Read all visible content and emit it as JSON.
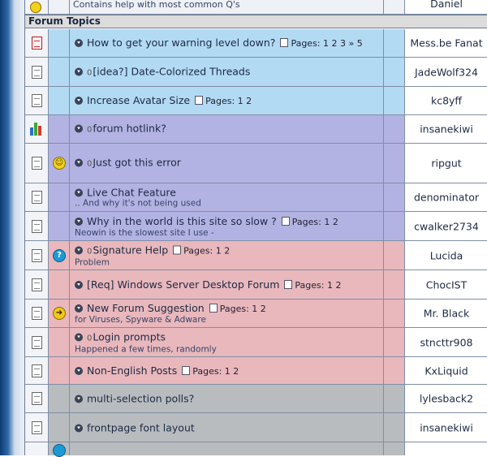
{
  "top_row": {
    "description": "Contains help with most common Q's",
    "author": "Daniel"
  },
  "section": {
    "title": "Forum Topics"
  },
  "pages_label": "Pages:",
  "topics": [
    {
      "title": "How to get your warning level down?",
      "pages": "1 2 3 » 5",
      "author": "Mess.be Fanat",
      "color": "blue"
    },
    {
      "title": "[idea?] Date-Colorized Threads",
      "poll": "0",
      "author": "JadeWolf324",
      "color": "blue"
    },
    {
      "title": "Increase Avatar Size",
      "pages": "1 2",
      "author": "kc8yff",
      "color": "blue"
    },
    {
      "title": "forum hotlink?",
      "poll": "0",
      "author": "insanekiwi",
      "color": "purple"
    },
    {
      "title": "Just got this error",
      "poll": "0",
      "author": "ripgut",
      "color": "purple"
    },
    {
      "title": "Live Chat Feature",
      "subtitle": ".. And why it's not being used",
      "author": "denominator",
      "color": "purple"
    },
    {
      "title": "Why in the world is this site so slow ?",
      "pages": "1 2",
      "subtitle": "Neowin is the slowest site I use -",
      "author": "cwalker2734",
      "color": "purple"
    },
    {
      "title": "Signature Help",
      "poll": "0",
      "pages": "1 2",
      "subtitle": "Problem",
      "author": "Lucida",
      "color": "pink"
    },
    {
      "title": "[Req] Windows Server Desktop Forum",
      "pages": "1 2",
      "author": "ChocIST",
      "color": "pink"
    },
    {
      "title": "New Forum Suggestion",
      "pages": "1 2",
      "subtitle": "for Viruses, Spyware & Adware",
      "author": "Mr. Black",
      "color": "pink"
    },
    {
      "title": "Login prompts",
      "poll": "0",
      "subtitle": "Happened a few times, randomly",
      "author": "stncttr908",
      "color": "pink"
    },
    {
      "title": "Non-English Posts",
      "pages": "1 2",
      "author": "KxLiquid",
      "color": "pink"
    },
    {
      "title": "multi-selection polls?",
      "author": "lylesback2",
      "color": "gray"
    },
    {
      "title": "frontpage font layout",
      "author": "insanekiwi",
      "color": "gray"
    }
  ],
  "icons": {
    "row_icons": [
      "hot-topic-icon",
      "topic-icon",
      "topic-icon",
      "poll-icon",
      "topic-icon",
      "topic-icon",
      "topic-icon",
      "topic-icon",
      "topic-icon",
      "topic-icon",
      "topic-icon",
      "topic-icon",
      "topic-icon",
      "topic-icon"
    ],
    "post_icons": [
      "",
      "",
      "",
      "",
      "smiley-icon",
      "",
      "",
      "question-icon",
      "",
      "arrow-icon",
      "",
      "",
      "",
      ""
    ]
  },
  "colors": {
    "blue": "#b2daf3",
    "purple": "#b3b3e3",
    "pink": "#e9b8bc",
    "gray": "#b9bcbf",
    "header_bg": "#dcdcdc"
  }
}
